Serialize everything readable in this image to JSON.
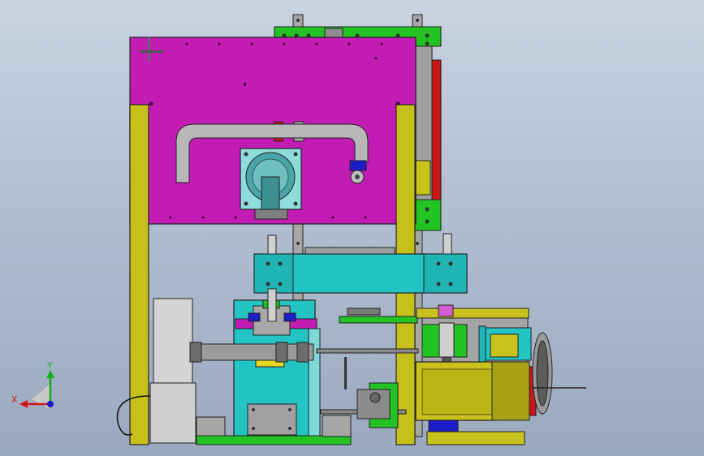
{
  "viewport": {
    "background_top": "#c9d3e1",
    "background_bottom": "#9aa9bf"
  },
  "triad": {
    "x_label": "X",
    "y_label": "Y",
    "x_color": "#d01818",
    "y_color": "#10b010",
    "z_color": "#1818d0"
  },
  "colors": {
    "magenta_plate": "#c21cb4",
    "yellow_frame": "#c8c01a",
    "green_part": "#23c323",
    "cyan_part": "#22c4c4",
    "grey_part": "#a5a5a5",
    "red_rail": "#c81818",
    "blue_part": "#1c1cc8",
    "motor_yellow": "#c9c21c",
    "light_grey": "#d4d4d4"
  }
}
